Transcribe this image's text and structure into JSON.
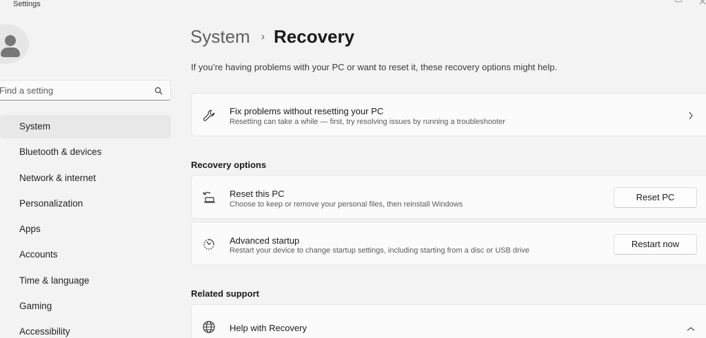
{
  "window": {
    "title": "Settings"
  },
  "search": {
    "placeholder": "Find a setting"
  },
  "sidebar": {
    "items": [
      {
        "label": "System",
        "active": true
      },
      {
        "label": "Bluetooth & devices"
      },
      {
        "label": "Network & internet"
      },
      {
        "label": "Personalization"
      },
      {
        "label": "Apps"
      },
      {
        "label": "Accounts"
      },
      {
        "label": "Time & language"
      },
      {
        "label": "Gaming"
      },
      {
        "label": "Accessibility"
      }
    ]
  },
  "header": {
    "breadcrumb_parent": "System",
    "breadcrumb_separator": "›",
    "breadcrumb_current": "Recovery"
  },
  "intro_text": "If you’re having problems with your PC or want to reset it, these recovery options might help.",
  "fix_card": {
    "icon": "wrench-icon",
    "title": "Fix problems without resetting your PC",
    "subtitle": "Resetting can take a while — first, try resolving issues by running a troubleshooter"
  },
  "recovery_options": {
    "heading": "Recovery options",
    "reset": {
      "icon": "reset-pc-icon",
      "title": "Reset this PC",
      "subtitle": "Choose to keep or remove your personal files, then reinstall Windows",
      "button": "Reset PC"
    },
    "advanced": {
      "icon": "advanced-startup-icon",
      "title": "Advanced startup",
      "subtitle": "Restart your device to change startup settings, including starting from a disc or USB drive",
      "button": "Restart now"
    }
  },
  "related_support": {
    "heading": "Related support",
    "help": {
      "icon": "globe-icon",
      "title": "Help with Recovery"
    }
  },
  "colors": {
    "background": "#f3f3f3",
    "card": "#fbfbfb",
    "active_nav": "#e8e8e8"
  }
}
